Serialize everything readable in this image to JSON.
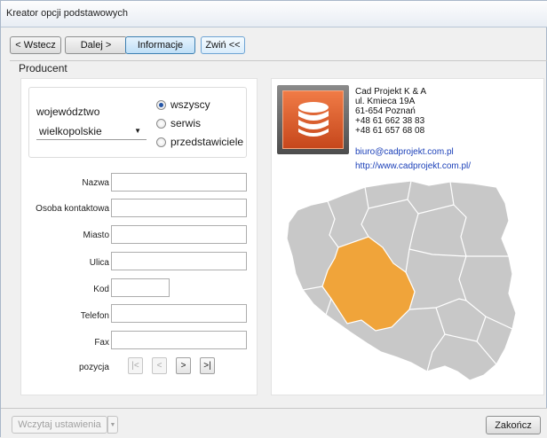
{
  "window": {
    "title": "Kreator opcji podstawowych"
  },
  "toolbar": {
    "back_label": "< Wstecz",
    "next_label": "Dalej >",
    "info_label": "Informacje",
    "collapse_label": "Zwiń <<"
  },
  "section": {
    "title": "Producent"
  },
  "filter": {
    "region_label": "województwo",
    "region_value": "wielkopolskie",
    "options": [
      {
        "label": "wszyscy",
        "selected": true
      },
      {
        "label": "serwis",
        "selected": false
      },
      {
        "label": "przedstawiciele",
        "selected": false
      }
    ]
  },
  "form": {
    "name_label": "Nazwa",
    "contact_label": "Osoba kontaktowa",
    "city_label": "Miasto",
    "street_label": "Ulica",
    "zip_label": "Kod",
    "phone_label": "Telefon",
    "fax_label": "Fax",
    "name_value": "",
    "contact_value": "",
    "city_value": "",
    "street_value": "",
    "zip_value": "",
    "phone_value": "",
    "fax_value": ""
  },
  "navigation": {
    "position_label": "pozycja",
    "first": "|<",
    "prev": "<",
    "next": ">",
    "last": ">|"
  },
  "company": {
    "name": "Cad Projekt K & A",
    "street": "ul. Kmieca 19A",
    "city": "61-654 Poznań",
    "phone1": "+48 61 662 38 83",
    "phone2": "+48 61 657 68 08",
    "email": "biuro@cadprojekt.com.pl",
    "website": "http://www.cadprojekt.com.pl/"
  },
  "map": {
    "highlighted_region": "wielkopolskie",
    "highlight_color": "#f0a43a",
    "base_color": "#c8c8c8"
  },
  "footer": {
    "load_label": "Wczytaj ustawienia",
    "finish_label": "Zakończ"
  },
  "colors": {
    "accent_button": "#bfdff7",
    "logo_orange": "#e0602c"
  }
}
